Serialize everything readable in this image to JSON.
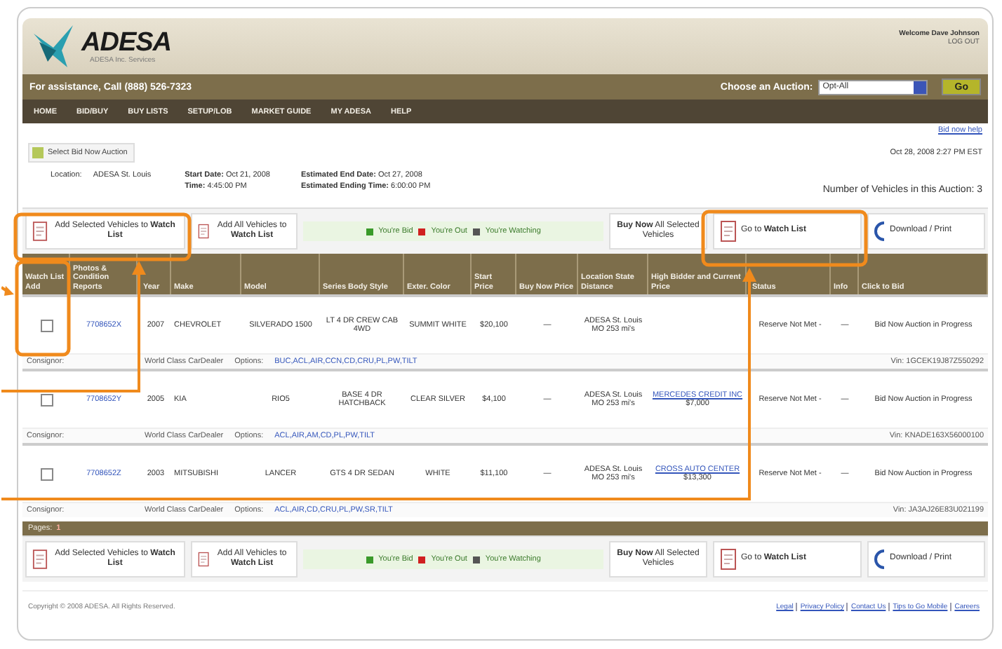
{
  "header": {
    "logo": "ADESA",
    "tagline": "ADESA Inc. Services",
    "welcome": "Welcome Dave Johnson",
    "logout": "LOG OUT"
  },
  "assist_bar": {
    "text": "For assistance, Call (888) 526-7323",
    "auction_label": "Choose an Auction:",
    "auction_value": "Opt-All",
    "go": "Go"
  },
  "nav": [
    "HOME",
    "BID/BUY",
    "BUY LISTS",
    "SETUP/LOB",
    "MARKET GUIDE",
    "MY ADESA",
    "HELP"
  ],
  "help_link": "Bid now help",
  "select_button": "Select Bid Now Auction",
  "datetime": "Oct 28, 2008 2:27 PM EST",
  "auction_info": {
    "location_label": "Location:",
    "location": "ADESA St. Louis",
    "start_date": "**Start Date:** Oct 21, 2008",
    "start_time": "**Time:** 4:45:00 PM",
    "end_date": "**Estimated End Date:** Oct 27, 2008",
    "end_time": "**Estimated Ending Time:** 6:00:00 PM",
    "count": "Number of Vehicles in this Auction: 3"
  },
  "toolbars": [
    {
      "add_selected": "Add Selected Vehicles to **Watch List**",
      "add_all": "Add All Vehicles to **Watch List**",
      "legend": [
        {
          "label": "You're Bid",
          "color": "#3a9a2a"
        },
        {
          "label": "You're Out",
          "color": "#d02020"
        },
        {
          "label": "You're Watching",
          "color": "#555555"
        }
      ],
      "buy_now": "**Buy Now** All Selected Vehicles",
      "go_watch": "Go to **Watch List**",
      "download": "Download / Print"
    },
    {
      "add_selected": "Add Selected Vehicles to **Watch List**",
      "add_all": "Add All Vehicles to **Watch List**",
      "legend": [
        {
          "label": "You're Bid",
          "color": "#3a9a2a"
        },
        {
          "label": "You're Out",
          "color": "#d02020"
        },
        {
          "label": "You're Watching",
          "color": "#555555"
        }
      ],
      "buy_now": "**Buy Now** All Selected Vehicles",
      "go_watch": "Go to **Watch List**",
      "download": "Download / Print"
    }
  ],
  "table": {
    "columns": [
      "Watch List Add",
      "Photos & Condition Reports",
      "Year",
      "Make",
      "Model",
      "Series Body Style",
      "Exter. Color",
      "Start Price",
      "Buy Now Price",
      "Location State Distance",
      "High Bidder and Current Price",
      "Status",
      "Info",
      "Click to Bid"
    ],
    "rows": [
      {
        "checked": false,
        "photos": "7708652X",
        "year": "2007",
        "make": "CHEVROLET",
        "model": "SILVERADO 1500",
        "series": "LT 4 DR CREW CAB 4WD",
        "exterior_color": "SUMMIT WHITE",
        "start_price": "$20,100",
        "buy_now": "—",
        "location": "ADESA St. Louis MO 253 mi's",
        "high_bidder": "",
        "high_price": "",
        "status": "Reserve Not Met -",
        "info": "—",
        "bid": "Bid Now Auction in Progress",
        "consignor_label": "Consignor:",
        "consignor": "World Class CarDealer",
        "options_label": "Options:",
        "options": "BUC,ACL,AIR,CCN,CD,CRU,PL,PW,TILT",
        "vin": "Vin: 1GCEK19J87Z550292"
      },
      {
        "checked": false,
        "photos": "7708652Y",
        "year": "2005",
        "make": "KIA",
        "model": "RIO5",
        "series": "BASE 4 DR HATCHBACK",
        "exterior_color": "CLEAR SILVER",
        "start_price": "$4,100",
        "buy_now": "—",
        "location": "ADESA St. Louis MO 253 mi's",
        "high_bidder": "MERCEDES CREDIT INC",
        "high_price": "$7,000",
        "status": "Reserve Not Met -",
        "info": "—",
        "bid": "Bid Now Auction in Progress",
        "consignor_label": "Consignor:",
        "consignor": "World Class CarDealer",
        "options_label": "Options:",
        "options": "ACL,AIR,AM,CD,PL,PW,TILT",
        "vin": "Vin: KNADE163X56000100"
      },
      {
        "checked": false,
        "photos": "7708652Z",
        "year": "2003",
        "make": "MITSUBISHI",
        "model": "LANCER",
        "series": "GTS 4 DR SEDAN",
        "exterior_color": "WHITE",
        "start_price": "$11,100",
        "buy_now": "—",
        "location": "ADESA St. Louis MO 253 mi's",
        "high_bidder": "CROSS AUTO CENTER",
        "high_price": "$13,300",
        "status": "Reserve Not Met -",
        "info": "—",
        "bid": "Bid Now Auction in Progress",
        "consignor_label": "Consignor:",
        "consignor": "World Class CarDealer",
        "options_label": "Options:",
        "options": "ACL,AIR,CD,CRU,PL,PW,SR,TILT",
        "vin": "Vin: JA3AJ26E83U021199"
      }
    ]
  },
  "pages": {
    "label": "Pages:",
    "current": "1"
  },
  "footer": {
    "copyright": "Copyright © 2008 ADESA. All Rights Reserved.",
    "links": [
      "Legal",
      "Privacy Policy",
      "Contact Us",
      "Tips to Go Mobile",
      "Careers"
    ]
  }
}
